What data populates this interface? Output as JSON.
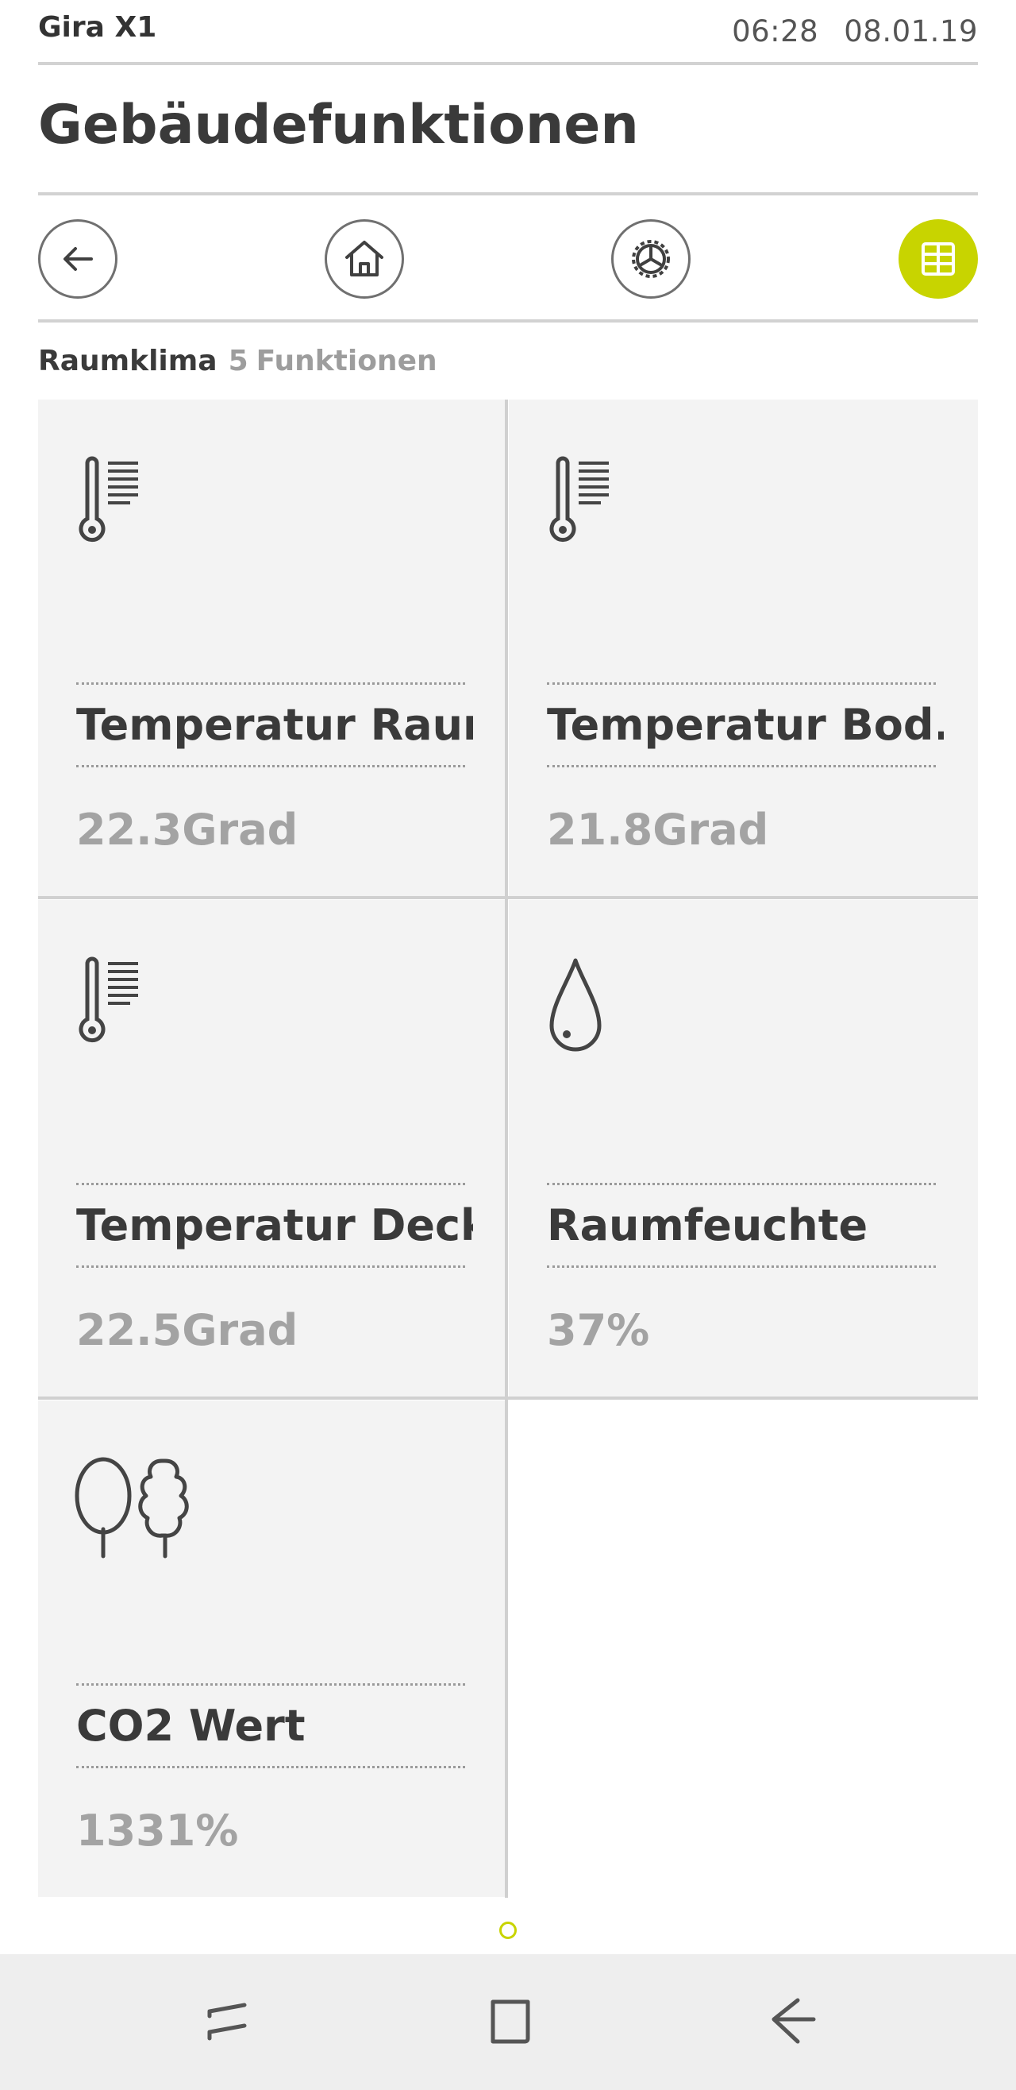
{
  "header": {
    "app_name": "Gira X1",
    "time": "06:28",
    "date": "08.01.19",
    "title": "Gebäudefunktionen"
  },
  "nav": {
    "buttons": [
      {
        "icon": "back-arrow-icon"
      },
      {
        "icon": "home-icon"
      },
      {
        "icon": "settings-gear-icon"
      },
      {
        "icon": "grid-view-icon",
        "active": true
      }
    ],
    "accent_color": "#c8d400"
  },
  "section": {
    "name": "Raumklima",
    "count": "5",
    "unit": "Funktionen"
  },
  "tiles": [
    {
      "label": "Temperatur Raum",
      "value": "22.3Grad",
      "icon": "thermometer-icon"
    },
    {
      "label": "Temperatur Bod...",
      "value": "21.8Grad",
      "icon": "thermometer-icon"
    },
    {
      "label": "Temperatur Decke",
      "value": "22.5Grad",
      "icon": "thermometer-icon"
    },
    {
      "label": "Raumfeuchte",
      "value": "37%",
      "icon": "water-drop-icon"
    },
    {
      "label": "CO2 Wert",
      "value": "1331%",
      "icon": "trees-icon"
    }
  ],
  "pager": {
    "pages": 1,
    "current": 1
  },
  "system_nav": {
    "buttons": [
      "recent-apps-icon",
      "home-square-icon",
      "back-icon"
    ]
  }
}
